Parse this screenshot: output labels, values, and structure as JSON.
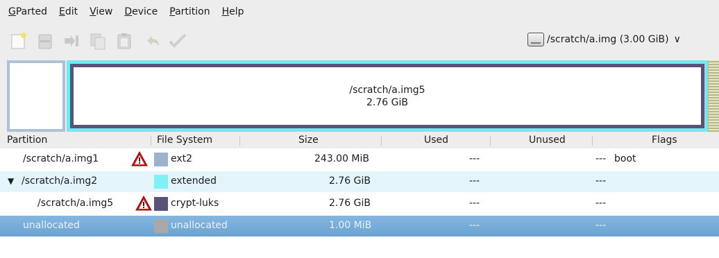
{
  "menubar": {
    "items": [
      {
        "label": "GParted",
        "underline": "G",
        "rest": "Parted"
      },
      {
        "label": "Edit",
        "underline": "E",
        "rest": "dit"
      },
      {
        "label": "View",
        "underline": "V",
        "rest": "iew"
      },
      {
        "label": "Device",
        "underline": "D",
        "rest": "evice"
      },
      {
        "label": "Partition",
        "underline": "P",
        "rest": "artition"
      },
      {
        "label": "Help",
        "underline": "H",
        "rest": "elp"
      }
    ]
  },
  "toolbar": {
    "icons": [
      "new-partition-icon",
      "delete-icon",
      "resize-move-icon",
      "copy-icon",
      "paste-icon",
      "undo-icon",
      "apply-icon"
    ]
  },
  "device": {
    "label": "/scratch/a.img  (3.00 GiB)"
  },
  "diskmap": {
    "main_partition_name": "/scratch/a.img5",
    "main_partition_size": "2.76 GiB"
  },
  "table": {
    "headers": {
      "partition": "Partition",
      "filesystem": "File System",
      "size": "Size",
      "used": "Used",
      "unused": "Unused",
      "flags": "Flags"
    },
    "rows": [
      {
        "partition": "/scratch/a.img1",
        "filesystem": "ext2",
        "size": "243.00 MiB",
        "used": "---",
        "unused": "---",
        "flags": "boot",
        "color": "#9db3cd"
      },
      {
        "partition": "/scratch/a.img2",
        "filesystem": "extended",
        "size": "2.76 GiB",
        "used": "---",
        "unused": "---",
        "flags": "",
        "color": "#7ef1f7",
        "expander": "▼"
      },
      {
        "partition": "/scratch/a.img5",
        "filesystem": "crypt-luks",
        "size": "2.76 GiB",
        "used": "---",
        "unused": "---",
        "flags": "",
        "color": "#5a5278"
      },
      {
        "partition": "unallocated",
        "filesystem": "unallocated",
        "size": "1.00 MiB",
        "used": "---",
        "unused": "---",
        "flags": "",
        "color": "#a8a8a8"
      }
    ]
  },
  "colors": {
    "selection": "#6aa3d2",
    "extended": "#6fe9f2",
    "luks_border": "#5a5278",
    "ext2": "#aec0d4",
    "warning": "#cc0000"
  }
}
